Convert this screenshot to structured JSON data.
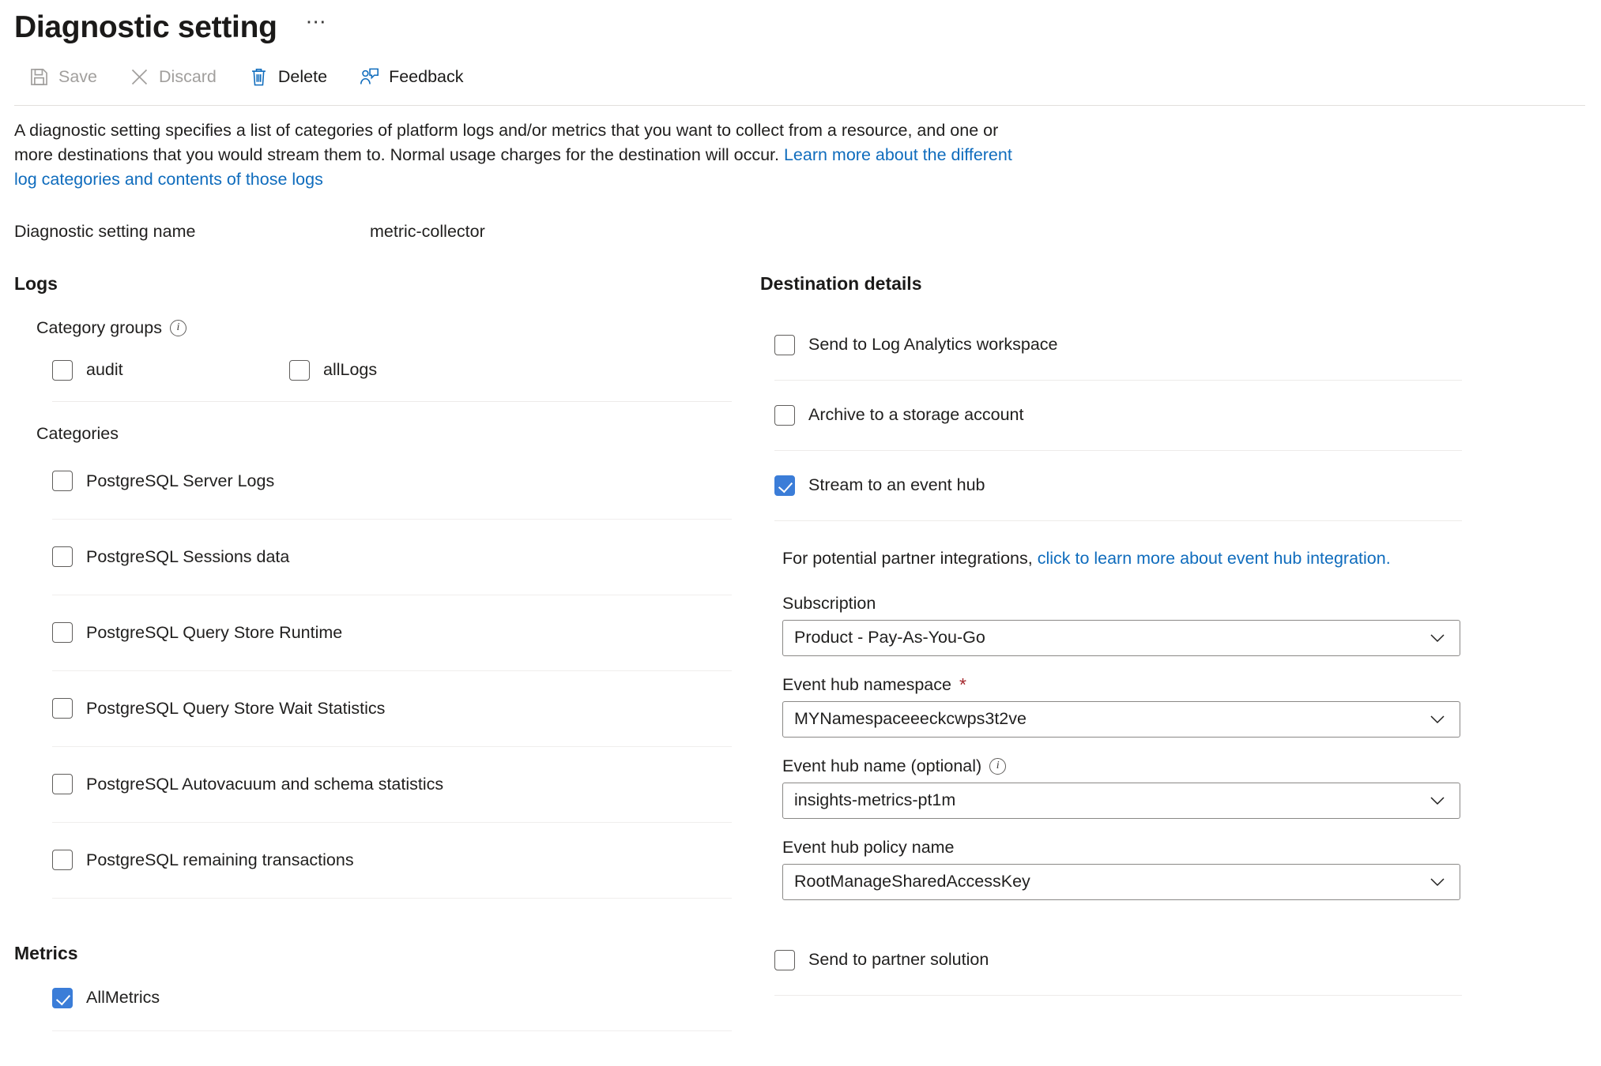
{
  "header": {
    "title": "Diagnostic setting",
    "overflow_label": "⋯"
  },
  "toolbar": {
    "items": [
      {
        "label": "Save",
        "icon": "save-icon",
        "enabled": false
      },
      {
        "label": "Discard",
        "icon": "discard-icon",
        "enabled": false
      },
      {
        "label": "Delete",
        "icon": "delete-icon",
        "enabled": true
      },
      {
        "label": "Feedback",
        "icon": "feedback-icon",
        "enabled": true
      }
    ]
  },
  "description": {
    "text_part1": "A diagnostic setting specifies a list of categories of platform logs and/or metrics that you want to collect from a resource, and one or more destinations that you would stream them to. Normal usage charges for the destination will occur. ",
    "link_text": "Learn more about the different log categories and contents of those logs"
  },
  "setting_name": {
    "label": "Diagnostic setting name",
    "value": "metric-collector"
  },
  "logs": {
    "section_title": "Logs",
    "category_groups_label": "Category groups",
    "category_groups_info": "info-icon",
    "groups": [
      {
        "label": "audit",
        "checked": false
      },
      {
        "label": "allLogs",
        "checked": false
      }
    ],
    "categories_label": "Categories",
    "categories": [
      {
        "label": "PostgreSQL Server Logs",
        "checked": false
      },
      {
        "label": "PostgreSQL Sessions data",
        "checked": false
      },
      {
        "label": "PostgreSQL Query Store Runtime",
        "checked": false
      },
      {
        "label": "PostgreSQL Query Store Wait Statistics",
        "checked": false
      },
      {
        "label": "PostgreSQL Autovacuum and schema statistics",
        "checked": false
      },
      {
        "label": "PostgreSQL remaining transactions",
        "checked": false
      }
    ]
  },
  "metrics": {
    "section_title": "Metrics",
    "items": [
      {
        "label": "AllMetrics",
        "checked": true
      }
    ]
  },
  "destination": {
    "section_title": "Destination details",
    "options": [
      {
        "label": "Send to Log Analytics workspace",
        "checked": false
      },
      {
        "label": "Archive to a storage account",
        "checked": false
      },
      {
        "label": "Stream to an event hub",
        "checked": true
      }
    ],
    "partner_note_prefix": "For potential partner integrations, ",
    "partner_note_link": "click to learn more about event hub integration.",
    "fields": [
      {
        "label": "Subscription",
        "required": false,
        "info": false,
        "value": "Product - Pay-As-You-Go"
      },
      {
        "label": "Event hub namespace",
        "required": true,
        "info": false,
        "value": "MYNamespaceeeckcwps3t2ve"
      },
      {
        "label": "Event hub name (optional)",
        "required": false,
        "info": true,
        "value": "insights-metrics-pt1m"
      },
      {
        "label": "Event hub policy name",
        "required": false,
        "info": false,
        "value": "RootManageSharedAccessKey"
      }
    ],
    "partner_solution": {
      "label": "Send to partner solution",
      "checked": false
    }
  },
  "colors": {
    "accent_blue": "#3b7dd8",
    "link_blue": "#0f6cbd",
    "icon_blue": "#0f6cbd",
    "required_red": "#a4262c",
    "disabled_gray": "#a19f9d",
    "text": "#201f1e",
    "rule": "#edebe9"
  }
}
